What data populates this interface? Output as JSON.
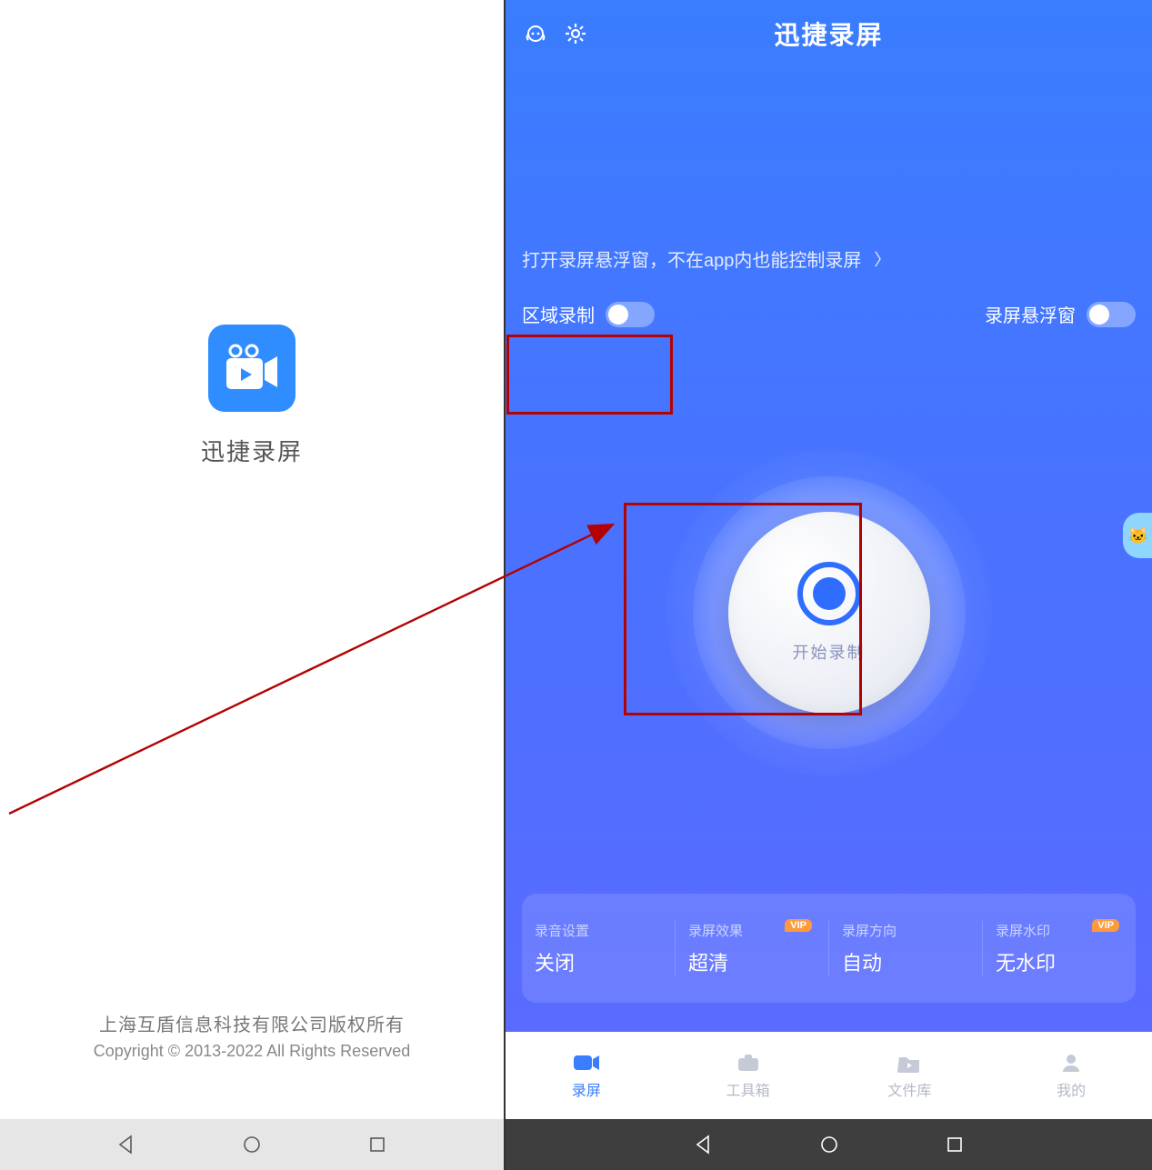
{
  "left": {
    "appName": "迅捷录屏",
    "company": "上海互盾信息科技有限公司版权所有",
    "copyright": "Copyright © 2013-2022 All Rights Reserved"
  },
  "right": {
    "header": {
      "title": "迅捷录屏"
    },
    "tip": "打开录屏悬浮窗，不在app内也能控制录屏",
    "toggles": {
      "region": "区域录制",
      "float": "录屏悬浮窗",
      "regionOn": false,
      "floatOn": false
    },
    "record": {
      "label": "开始录制"
    },
    "settings": [
      {
        "label": "录音设置",
        "value": "关闭",
        "vip": false
      },
      {
        "label": "录屏效果",
        "value": "超清",
        "vip": true
      },
      {
        "label": "录屏方向",
        "value": "自动",
        "vip": false
      },
      {
        "label": "录屏水印",
        "value": "无水印",
        "vip": true
      }
    ],
    "nav": [
      {
        "label": "录屏",
        "active": true
      },
      {
        "label": "工具箱",
        "active": false
      },
      {
        "label": "文件库",
        "active": false
      },
      {
        "label": "我的",
        "active": false
      }
    ]
  },
  "vipText": "VIP"
}
